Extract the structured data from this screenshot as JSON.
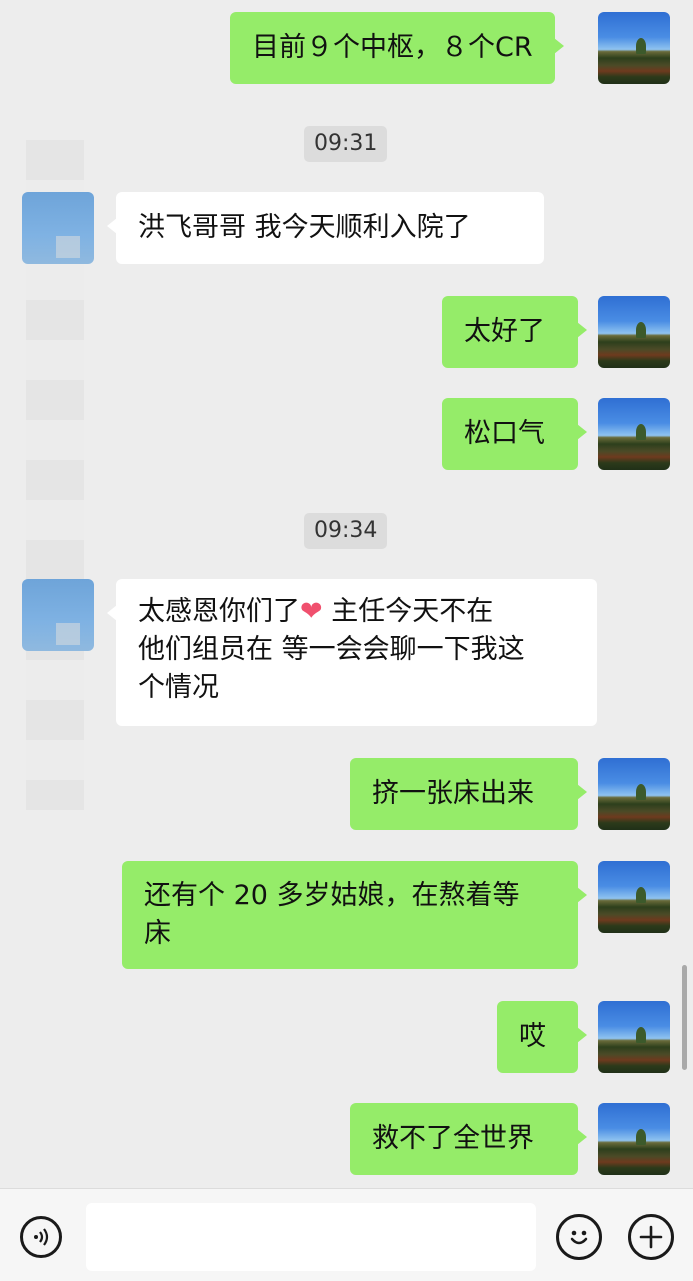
{
  "messages": [
    {
      "text": "目前９个中枢，８个CR"
    },
    {
      "time": "09:31"
    },
    {
      "text": "洪飞哥哥 我今天顺利入院了"
    },
    {
      "text": "太好了"
    },
    {
      "text": "松口气"
    },
    {
      "time": "09:34"
    },
    {
      "text_a": "太感恩你们了",
      "heart": "❤",
      "text_b": " 主任今天不在",
      "line2": "他们组员在 等一会会聊一下我这",
      "line3": "个情况"
    },
    {
      "text": "挤一张床出来"
    },
    {
      "line1": "还有个 20 多岁姑娘，在熬着等",
      "line2": "床"
    },
    {
      "text": "哎"
    },
    {
      "text": "救不了全世界"
    }
  ],
  "input": {
    "value": "",
    "placeholder": ""
  },
  "icons": {
    "voice": "voice-icon",
    "emoji": "emoji-icon",
    "plus": "plus-icon"
  },
  "colors": {
    "me_bubble": "#95ec69",
    "them_bubble": "#ffffff",
    "background": "#ededed"
  }
}
